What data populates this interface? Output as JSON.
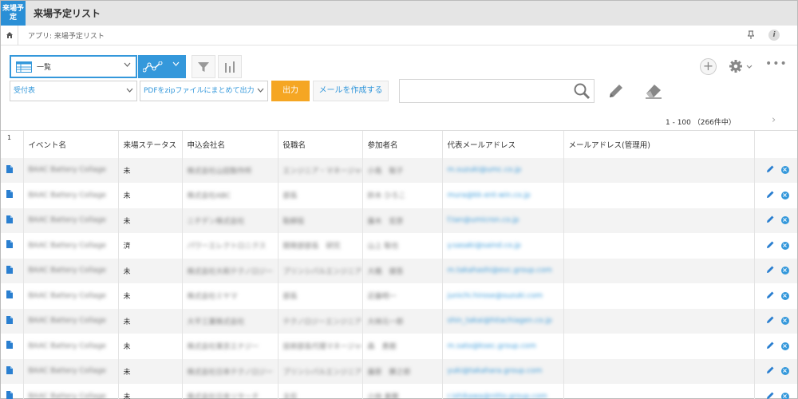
{
  "app": {
    "logo_text": "来場予定",
    "title": "来場予定リスト"
  },
  "breadcrumb": {
    "text": "アプリ: 来場予定リスト"
  },
  "toolbar": {
    "view_label": "一覧",
    "filter_icon": "funnel-icon",
    "graph_icon": "bar-chart-icon",
    "add_icon": "plus-icon",
    "gear_icon": "gear-icon",
    "more_icon": "more-icon"
  },
  "actions": {
    "report_select": "受付表",
    "pdf_select": "PDFをzipファイルにまとめて出力",
    "output_label": "出力",
    "mail_label": "メールを作成する",
    "search_value": ""
  },
  "pager": {
    "text": "1 - 100 （266件中）"
  },
  "colors": {
    "accent": "#3498db",
    "output_button": "#f5a623",
    "header_bg": "#e5e5e5"
  },
  "table": {
    "headers": [
      "イベント名",
      "来場ステータス",
      "申込会社名",
      "役職名",
      "参加者名",
      "代表メールアドレス",
      "メールアドレス(管理用)"
    ],
    "first_row_count": "1",
    "rows": [
      {
        "event": "BAAC Battery Collage",
        "status": "未",
        "company": "株式会社山田製作所",
        "title": "エンジニア・マネージャー",
        "name": "小島　聡子",
        "email": "m.suzuki@umc.co.jp",
        "email_admin": ""
      },
      {
        "event": "BAAC Battery Collage",
        "status": "未",
        "company": "株式会社ABC",
        "title": "部長",
        "name": "鈴木 ひろこ",
        "email": "mura@kk-ent-win.co.jp",
        "email_admin": ""
      },
      {
        "event": "BAAC Battery Collage",
        "status": "未",
        "company": "ニチデン株式会社",
        "title": "取締役",
        "name": "藤木　宏彦",
        "email": "f.tan@umicron.co.jp",
        "email_admin": ""
      },
      {
        "event": "BAAC Battery Collage",
        "status": "済",
        "company": "パワーエレクトロニクス",
        "title": "開発部部長　研究",
        "name": "山上 聡也",
        "email": "y.sasaki@saind.co.jp",
        "email_admin": ""
      },
      {
        "event": "BAAC Battery Collage",
        "status": "未",
        "company": "株式会社大和テクノロジー",
        "title": "プリンシパルエンジニア",
        "name": "大橋　健吾",
        "email": "m.takahashi@evc.group.com",
        "email_admin": ""
      },
      {
        "event": "BAAC Battery Collage",
        "status": "未",
        "company": "株式会社ミヤマ",
        "title": "部長",
        "name": "近藤明一",
        "email": "junichi.hirose@suzuki.com",
        "email_admin": ""
      },
      {
        "event": "BAAC Battery Collage",
        "status": "未",
        "company": "大平工業株式会社",
        "title": "テクノロジーエンジニア",
        "name": "大林元一郎",
        "email": "shin_takai@hitachiagen.co.jp",
        "email_admin": ""
      },
      {
        "event": "BAAC Battery Collage",
        "status": "未",
        "company": "株式会社東京エナジー",
        "title": "技術部長代理マネージャー",
        "name": "森　勇樹",
        "email": "m.sato@ksec.group.com",
        "email_admin": ""
      },
      {
        "event": "BAAC Battery Collage",
        "status": "未",
        "company": "株式会社日本テクノロジー",
        "title": "プリンシパルエンジニア",
        "name": "藤原　勝之郎",
        "email": "yuki@takahara.group.com",
        "email_admin": ""
      },
      {
        "event": "BAAC Battery Collage",
        "status": "未",
        "company": "株式会社日本リサーチ",
        "title": "主任",
        "name": "小林 美穂",
        "email": "r.ishikawa@nitto.group.com",
        "email_admin": ""
      }
    ]
  }
}
